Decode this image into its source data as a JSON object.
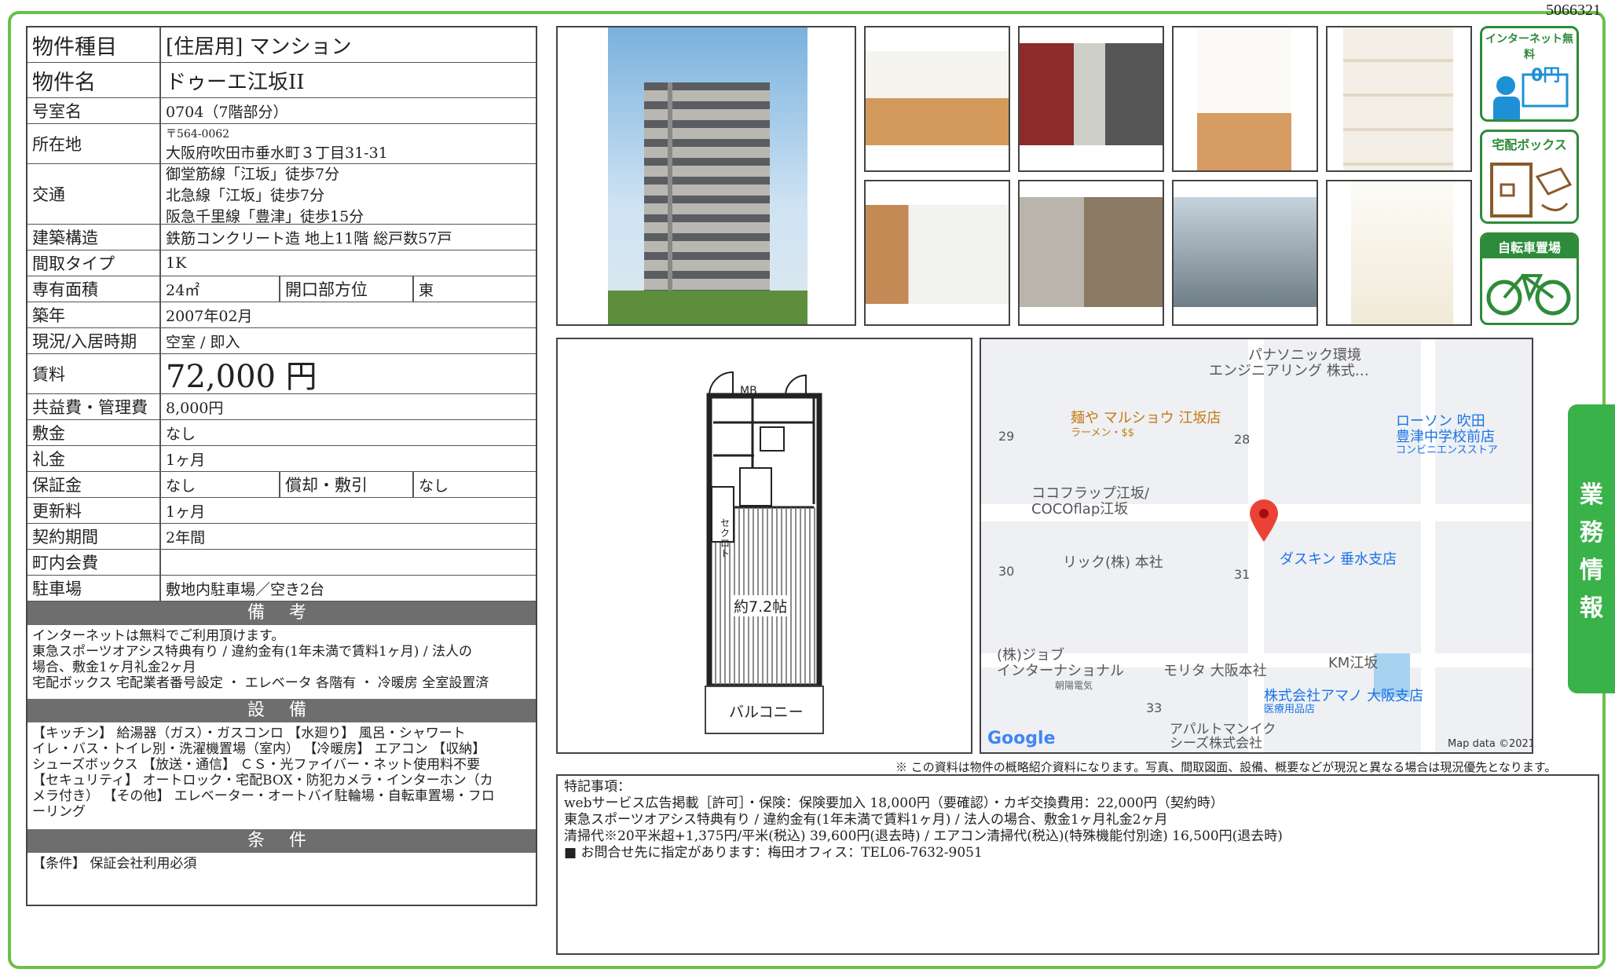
{
  "doc_id": "5066321",
  "property": {
    "type_label": "物件種目",
    "type_value": "[住居用]  マンション",
    "name_label": "物件名",
    "name_value": "ドゥーエ江坂II",
    "room_label": "号室名",
    "room_value": "0704（7階部分）",
    "address_label": "所在地",
    "postal": "〒564-0062",
    "address": "大阪府吹田市垂水町３丁目31-31",
    "transit_label": "交通",
    "transit": [
      "御堂筋線「江坂」徒歩7分",
      "北急線「江坂」徒歩7分",
      "阪急千里線「豊津」徒歩15分"
    ],
    "structure_label": "建築構造",
    "structure_value": "鉄筋コンクリート造 地上11階 総戸数57戸",
    "layout_label": "間取タイプ",
    "layout_value": "1K",
    "area_label": "専有面積",
    "area_value": "24㎡",
    "opening_label": "開口部方位",
    "opening_value": "東",
    "built_label": "築年",
    "built_value": "2007年02月",
    "status_label": "現況/入居時期",
    "status_value": "空室 /  即入",
    "rent_label": "賃料",
    "rent_value": "72,000 円",
    "fee_label": "共益費・管理費",
    "fee_value": "8,000円",
    "deposit_label": "敷金",
    "deposit_value": "なし",
    "keymoney_label": "礼金",
    "keymoney_value": "1ヶ月",
    "guarantee_label": "保証金",
    "guarantee_value": "なし",
    "amort_label": "償却・敷引",
    "amort_value": "なし",
    "renewal_label": "更新料",
    "renewal_value": "1ヶ月",
    "contract_label": "契約期間",
    "contract_value": "2年間",
    "assoc_label": "町内会費",
    "assoc_value": "",
    "parking_label": "駐車場",
    "parking_value": "敷地内駐車場／空き2台"
  },
  "remarks": {
    "title": "備 考",
    "lines": [
      "インターネットは無料でご利用頂けます。",
      "東急スポーツオアシス特典有り /  違約金有(1年未満で賃料1ヶ月) /  法人の",
      "場合、敷金1ヶ月礼金2ヶ月",
      "宅配ボックス 宅配業者番号設定 ・ エレベータ 各階有 ・ 冷暖房 全室設置済"
    ]
  },
  "equipment": {
    "title": "設 備",
    "lines": [
      "【キッチン】 給湯器（ガス）・ガスコンロ 【水廻り】 風呂・シャワート",
      "イレ・バス・トイレ別・洗濯機置場（室内） 【冷暖房】 エアコン 【収納】",
      "シューズボックス 【放送・通信】 ＣＳ・光ファイバー・ネット使用料不要",
      "【セキュリティ】 オートロック・宅配BOX・防犯カメラ・インターホン（カ",
      "メラ付き） 【その他】 エレベーター・オートバイ駐輪場・自転車置場・フロ",
      "ーリング"
    ]
  },
  "conditions": {
    "title": "条 件",
    "text": "【条件】 保証会社利用必須"
  },
  "badges": {
    "internet": "インターネット無料",
    "internet_price": "0円",
    "delivery": "宅配ボックス",
    "bicycle": "自転車置場"
  },
  "floorplan": {
    "room_label": "約7.2帖",
    "balcony": "バルコニー",
    "mb": "MB",
    "closet": "セクロト"
  },
  "map": {
    "labels": [
      "パナソニック環境",
      "エンジニアリング 株式…",
      "麺や マルショウ 江坂店",
      "ラーメン・$$",
      "ローソン 吹田",
      "豊津中学校前店",
      "コンビニエンスストア",
      "ココフラップ江坂/",
      "COCOflap江坂",
      "リック(株) 本社",
      "ダスキン 垂水支店",
      "KM江坂",
      "(株)ジョブ",
      "インターナショナル",
      "モリタ 大阪本社",
      "株式会社アマノ 大阪支店",
      "医療用品店",
      "アパルトマンイク",
      "シーズ株式会社",
      "朝陽電気"
    ],
    "blocks": [
      "29",
      "28",
      "30",
      "31",
      "33"
    ],
    "google": "Google",
    "credit": "Map data ©2021"
  },
  "disclaimer": "※ この資料は物件の概略紹介資料になります。写真、間取図面、設備、概要などが現況と異なる場合は現況優先となります。",
  "special": {
    "title": "特記事項：",
    "lines": [
      "webサービス広告掲載［許可］・保険：保険要加入 18,000円（要確認）・カギ交換費用：22,000円（契約時）",
      "東急スポーツオアシス特典有り /  違約金有(1年未満で賃料1ヶ月) /  法人の場合、敷金1ヶ月礼金2ヶ月",
      "清掃代※20平米超+1,375円/平米(税込) 39,600円(退去時) /  エアコン清掃代(税込)(特殊機能付別途) 16,500円(退去時)",
      "■ お問合せ先に指定があります：梅田オフィス：TEL06-7632-9051"
    ]
  },
  "side_tab": [
    "業",
    "務",
    "情",
    "報"
  ]
}
